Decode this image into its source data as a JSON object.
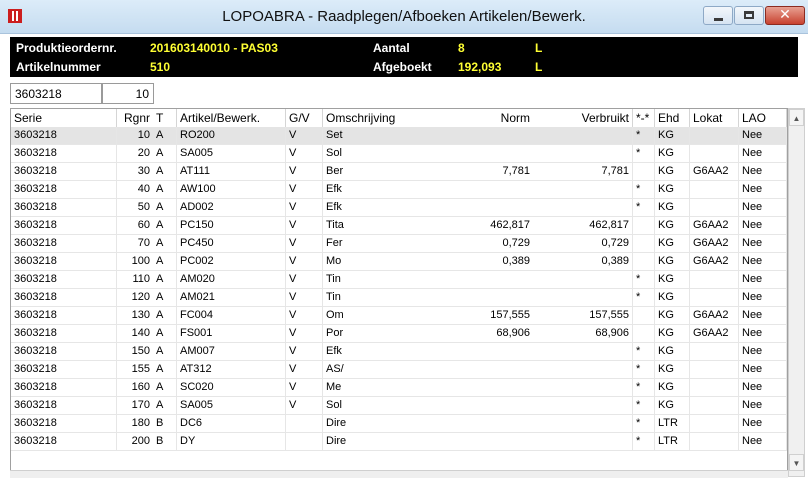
{
  "window": {
    "title": "LOPOABRA - Raadplegen/Afboeken Artikelen/Bewerk."
  },
  "info": {
    "po_label": "Produktieordernr.",
    "po_value": "201603140010 - PAS03",
    "art_label": "Artikelnummer",
    "art_value": "510",
    "aantal_label": "Aantal",
    "aantal_value": "8",
    "aantal_unit": "L",
    "afgeboekt_label": "Afgeboekt",
    "afgeboekt_value": "192,093",
    "afgeboekt_unit": "L"
  },
  "filter": {
    "serie": "3603218",
    "rgnr": "10"
  },
  "columns": [
    "Serie",
    "Rgnr",
    "T",
    "Artikel/Bewerk.",
    "G/V",
    "Omschrijving",
    "Norm",
    "Verbruikt",
    "*-*",
    "Ehd",
    "Lokat",
    "LAO"
  ],
  "rows": [
    {
      "serie": "3603218",
      "rgnr": "10",
      "t": "A",
      "art": "RO200",
      "gv": "V",
      "oms": "Set",
      "norm": "",
      "verb": "",
      "star": "*",
      "ehd": "KG",
      "lok": "",
      "lao": "Nee"
    },
    {
      "serie": "3603218",
      "rgnr": "20",
      "t": "A",
      "art": "SA005",
      "gv": "V",
      "oms": "Sol",
      "norm": "",
      "verb": "",
      "star": "*",
      "ehd": "KG",
      "lok": "",
      "lao": "Nee"
    },
    {
      "serie": "3603218",
      "rgnr": "30",
      "t": "A",
      "art": "AT111",
      "gv": "V",
      "oms": "Ber",
      "norm": "7,781",
      "verb": "7,781",
      "star": "",
      "ehd": "KG",
      "lok": "G6AA2",
      "lao": "Nee"
    },
    {
      "serie": "3603218",
      "rgnr": "40",
      "t": "A",
      "art": "AW100",
      "gv": "V",
      "oms": "Efk",
      "norm": "",
      "verb": "",
      "star": "*",
      "ehd": "KG",
      "lok": "",
      "lao": "Nee"
    },
    {
      "serie": "3603218",
      "rgnr": "50",
      "t": "A",
      "art": "AD002",
      "gv": "V",
      "oms": "Efk",
      "norm": "",
      "verb": "",
      "star": "*",
      "ehd": "KG",
      "lok": "",
      "lao": "Nee"
    },
    {
      "serie": "3603218",
      "rgnr": "60",
      "t": "A",
      "art": "PC150",
      "gv": "V",
      "oms": "Tita",
      "norm": "462,817",
      "verb": "462,817",
      "star": "",
      "ehd": "KG",
      "lok": "G6AA2",
      "lao": "Nee"
    },
    {
      "serie": "3603218",
      "rgnr": "70",
      "t": "A",
      "art": "PC450",
      "gv": "V",
      "oms": "Fer",
      "norm": "0,729",
      "verb": "0,729",
      "star": "",
      "ehd": "KG",
      "lok": "G6AA2",
      "lao": "Nee"
    },
    {
      "serie": "3603218",
      "rgnr": "100",
      "t": "A",
      "art": "PC002",
      "gv": "V",
      "oms": "Mo",
      "norm": "0,389",
      "verb": "0,389",
      "star": "",
      "ehd": "KG",
      "lok": "G6AA2",
      "lao": "Nee"
    },
    {
      "serie": "3603218",
      "rgnr": "110",
      "t": "A",
      "art": "AM020",
      "gv": "V",
      "oms": "Tin",
      "norm": "",
      "verb": "",
      "star": "*",
      "ehd": "KG",
      "lok": "",
      "lao": "Nee"
    },
    {
      "serie": "3603218",
      "rgnr": "120",
      "t": "A",
      "art": "AM021",
      "gv": "V",
      "oms": "Tin",
      "norm": "",
      "verb": "",
      "star": "*",
      "ehd": "KG",
      "lok": "",
      "lao": "Nee"
    },
    {
      "serie": "3603218",
      "rgnr": "130",
      "t": "A",
      "art": "FC004",
      "gv": "V",
      "oms": "Om",
      "norm": "157,555",
      "verb": "157,555",
      "star": "",
      "ehd": "KG",
      "lok": "G6AA2",
      "lao": "Nee"
    },
    {
      "serie": "3603218",
      "rgnr": "140",
      "t": "A",
      "art": "FS001",
      "gv": "V",
      "oms": "Por",
      "norm": "68,906",
      "verb": "68,906",
      "star": "",
      "ehd": "KG",
      "lok": "G6AA2",
      "lao": "Nee"
    },
    {
      "serie": "3603218",
      "rgnr": "150",
      "t": "A",
      "art": "AM007",
      "gv": "V",
      "oms": "Efk",
      "norm": "",
      "verb": "",
      "star": "*",
      "ehd": "KG",
      "lok": "",
      "lao": "Nee"
    },
    {
      "serie": "3603218",
      "rgnr": "155",
      "t": "A",
      "art": "AT312",
      "gv": "V",
      "oms": "AS/",
      "norm": "",
      "verb": "",
      "star": "*",
      "ehd": "KG",
      "lok": "",
      "lao": "Nee"
    },
    {
      "serie": "3603218",
      "rgnr": "160",
      "t": "A",
      "art": "SC020",
      "gv": "V",
      "oms": "Me",
      "norm": "",
      "verb": "",
      "star": "*",
      "ehd": "KG",
      "lok": "",
      "lao": "Nee"
    },
    {
      "serie": "3603218",
      "rgnr": "170",
      "t": "A",
      "art": "SA005",
      "gv": "V",
      "oms": "Sol",
      "norm": "",
      "verb": "",
      "star": "*",
      "ehd": "KG",
      "lok": "",
      "lao": "Nee"
    },
    {
      "serie": "3603218",
      "rgnr": "180",
      "t": "B",
      "art": "DC6",
      "gv": "",
      "oms": "Dire",
      "norm": "",
      "verb": "",
      "star": "*",
      "ehd": "LTR",
      "lok": "",
      "lao": "Nee"
    },
    {
      "serie": "3603218",
      "rgnr": "200",
      "t": "B",
      "art": "DY",
      "gv": "",
      "oms": "Dire",
      "norm": "",
      "verb": "",
      "star": "*",
      "ehd": "LTR",
      "lok": "",
      "lao": "Nee"
    }
  ],
  "scroll": {
    "up": "▲",
    "down": "▼"
  }
}
